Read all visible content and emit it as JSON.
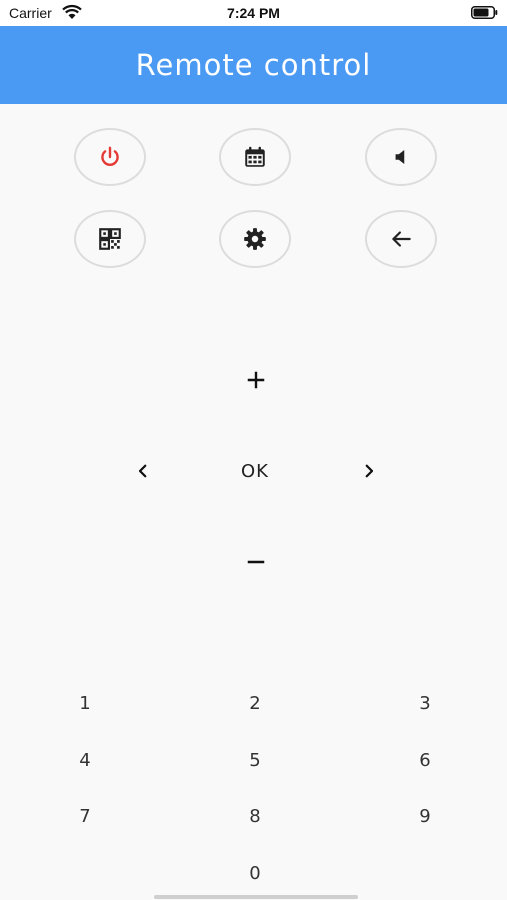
{
  "status_bar": {
    "carrier": "Carrier",
    "time": "7:24 PM"
  },
  "app_bar": {
    "title": "Remote control"
  },
  "colors": {
    "app_bar": "#4a99f2",
    "power_icon": "#e53935",
    "icon": "#222222",
    "button_border": "#dcdcdc",
    "background": "#f9f9f9"
  },
  "top_buttons": [
    {
      "name": "power-button",
      "icon": "power-icon"
    },
    {
      "name": "calendar-button",
      "icon": "calendar-icon"
    },
    {
      "name": "mute-button",
      "icon": "speaker-icon"
    },
    {
      "name": "qr-code-button",
      "icon": "qr-code-icon"
    },
    {
      "name": "settings-button",
      "icon": "gear-icon"
    },
    {
      "name": "back-button",
      "icon": "arrow-left-icon"
    }
  ],
  "dpad": {
    "ok_label": "OK",
    "up_icon": "plus-icon",
    "down_icon": "minus-icon",
    "left_icon": "chevron-left-icon",
    "right_icon": "chevron-right-icon"
  },
  "keypad": {
    "digits": [
      "1",
      "2",
      "3",
      "4",
      "5",
      "6",
      "7",
      "8",
      "9",
      "0"
    ]
  }
}
